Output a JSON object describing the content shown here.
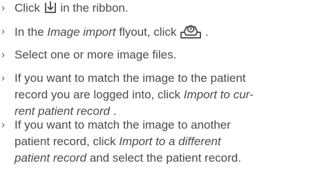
{
  "steps": [
    {
      "bullet": "›",
      "before": "Click",
      "after": "in the ribbon.",
      "icon": "import-arrow-icon"
    },
    {
      "bullet": "›",
      "before": "In the",
      "emphasis": "Image import",
      "middle": "flyout, click",
      "after": ".",
      "icon": "image-tray-icon"
    },
    {
      "bullet": "›",
      "text": "Select one or more image files."
    },
    {
      "bullet": "›",
      "line1": "If you want to match the image to the patient",
      "line2_before": "record you are logged into, click",
      "emphasis_line2": "Import to cur-",
      "emphasis_line3": "rent patient record",
      "after": "."
    },
    {
      "bullet": "›",
      "line1": "If you want to match the image to another",
      "line2_before": "patient record, click",
      "emphasis_line2": "Import to a different",
      "emphasis_line3": "patient record",
      "line3_after": "and select the patient record."
    }
  ],
  "colors": {
    "text": "#4a4a4a",
    "icon": "#5a5a5a"
  }
}
